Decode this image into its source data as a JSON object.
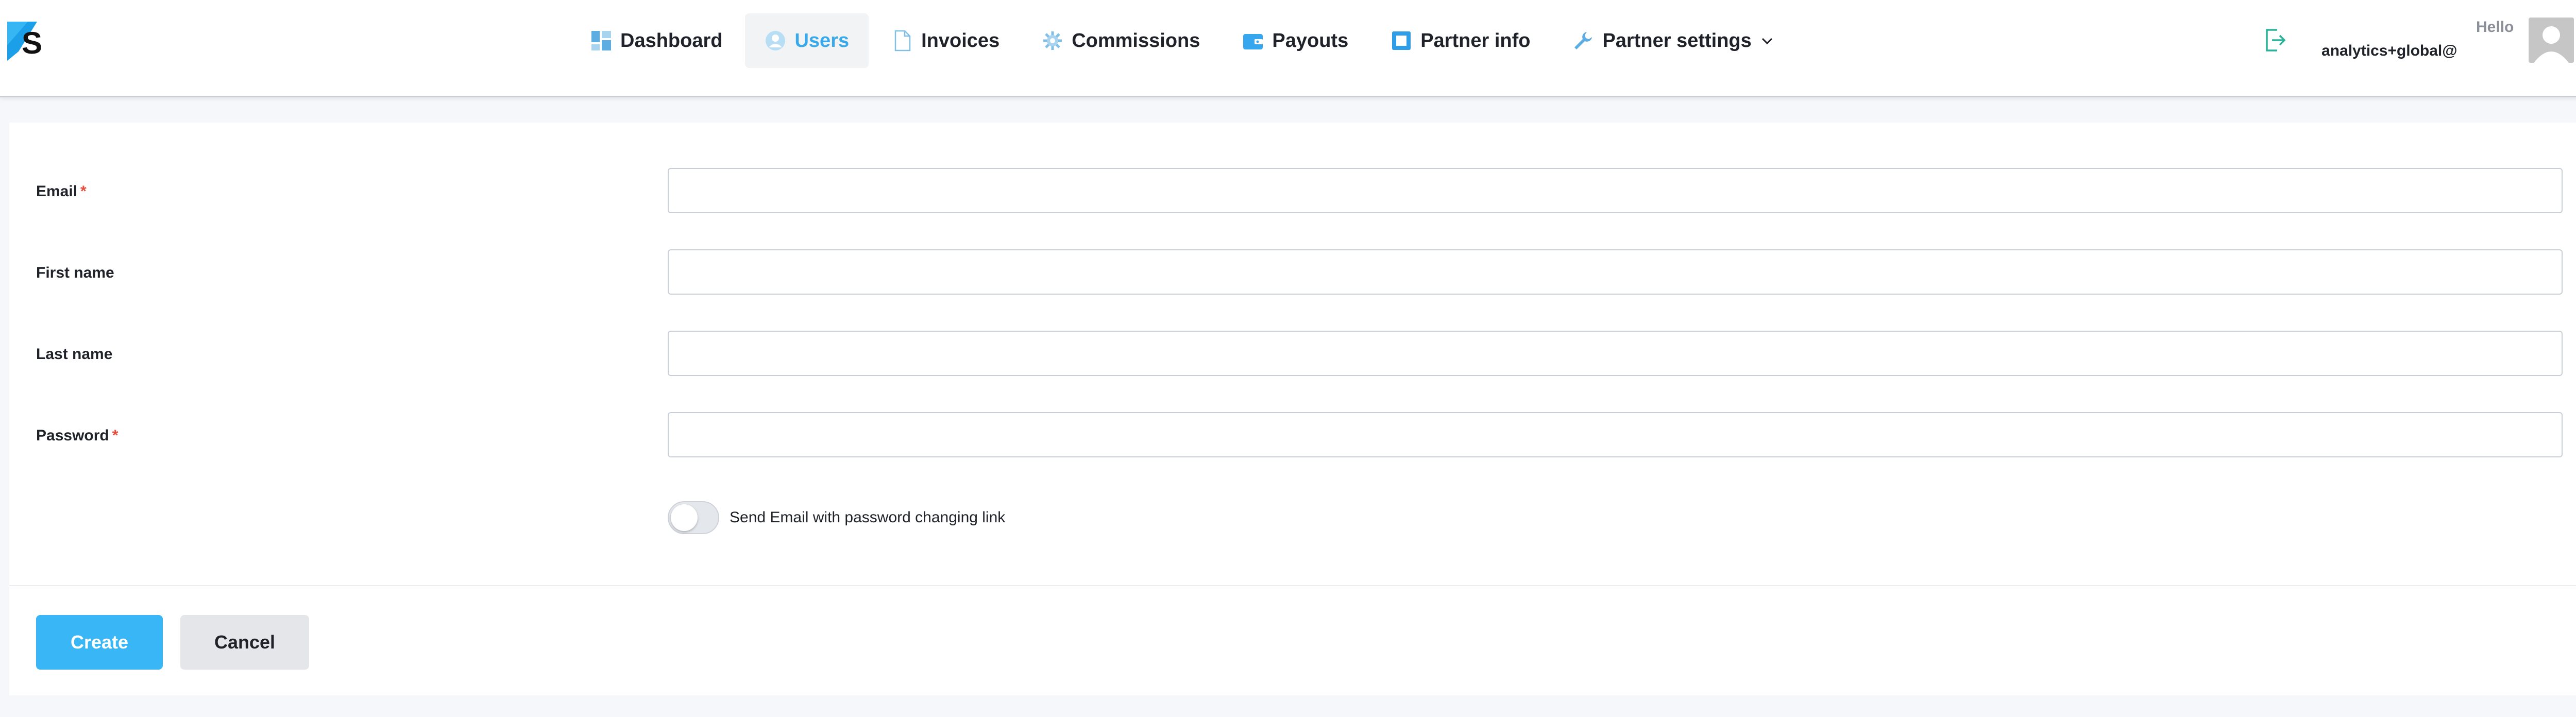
{
  "header": {
    "logo_icon": "zs-logo-icon",
    "nav": [
      {
        "label": "Dashboard",
        "icon": "dashboard-icon"
      },
      {
        "label": "Users",
        "icon": "user-icon",
        "active": true
      },
      {
        "label": "Invoices",
        "icon": "document-icon"
      },
      {
        "label": "Commissions",
        "icon": "gear-icon"
      },
      {
        "label": "Payouts",
        "icon": "wallet-icon"
      },
      {
        "label": "Partner info",
        "icon": "square-icon"
      },
      {
        "label": "Partner settings",
        "icon": "wrench-icon",
        "dropdown": true
      }
    ],
    "logout_icon": "logout-icon",
    "hello": "Hello",
    "user_email": "analytics+global@",
    "avatar_icon": "avatar-icon"
  },
  "form": {
    "fields": [
      {
        "label": "Email",
        "required": true,
        "value": "",
        "placeholder": ""
      },
      {
        "label": "First name",
        "required": false,
        "value": "",
        "placeholder": ""
      },
      {
        "label": "Last name",
        "required": false,
        "value": "",
        "placeholder": ""
      },
      {
        "label": "Password",
        "required": true,
        "value": "",
        "placeholder": ""
      }
    ],
    "required_mark": "*",
    "toggle_label": "Send Email with password changing link",
    "toggle_on": false
  },
  "actions": {
    "create": "Create",
    "cancel": "Cancel"
  },
  "colors": {
    "accent": "#38b6f5",
    "active_nav": "#3aa9ea",
    "required": "#e74c3c"
  }
}
